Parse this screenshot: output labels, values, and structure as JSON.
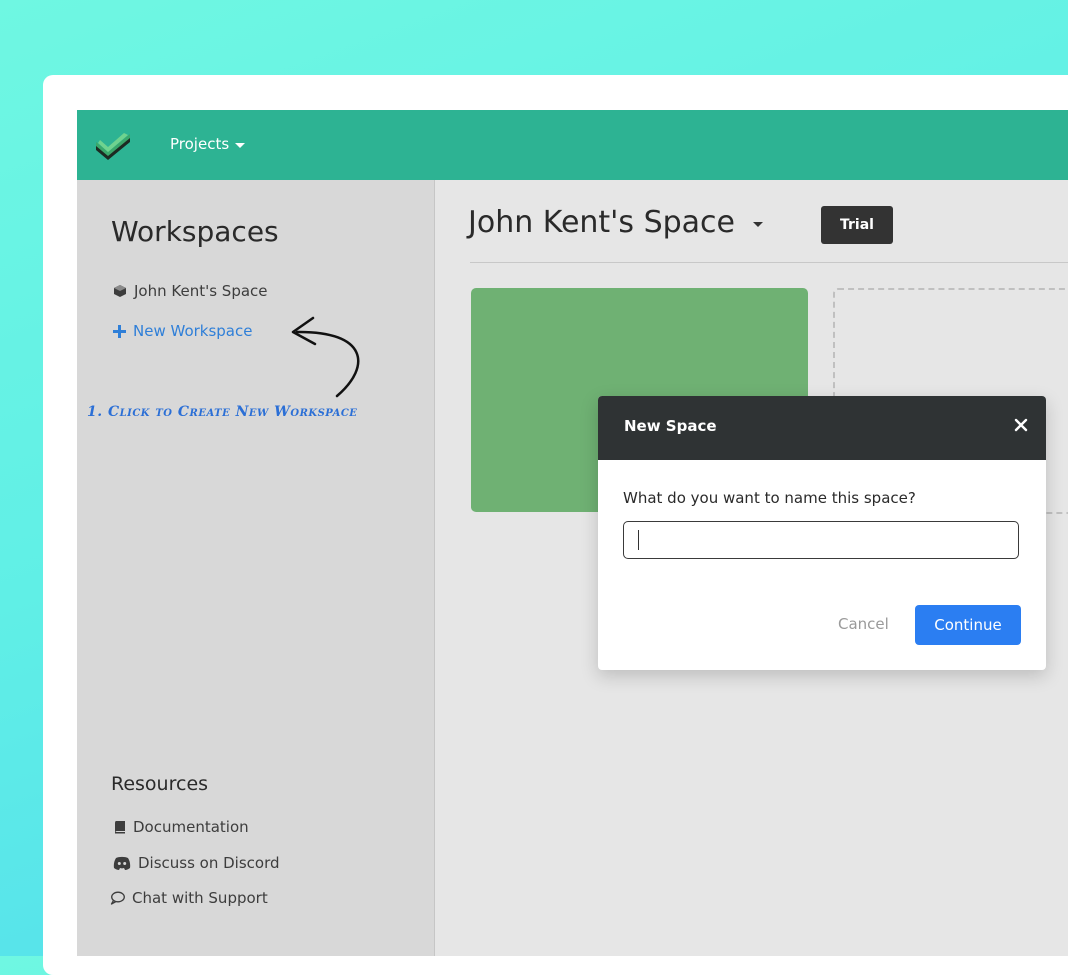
{
  "topbar": {
    "projects_label": "Projects"
  },
  "sidebar": {
    "title": "Workspaces",
    "workspaces": [
      {
        "label": "John Kent's Space",
        "icon": "cube-icon"
      }
    ],
    "new_workspace_label": "New Workspace",
    "annotation": "1. Click to Create New Workspace",
    "resources_title": "Resources",
    "resources": [
      {
        "label": "Documentation",
        "icon": "book-icon"
      },
      {
        "label": "Discuss on Discord",
        "icon": "discord-icon"
      },
      {
        "label": "Chat with Support",
        "icon": "chat-bubble-icon"
      }
    ]
  },
  "main": {
    "space_name": "John Kent's Space",
    "plan_badge": "Trial"
  },
  "modal": {
    "title": "New Space",
    "question": "What do you want to name this space?",
    "input_value": "",
    "cancel_label": "Cancel",
    "continue_label": "Continue"
  },
  "colors": {
    "topbar": "#2db393",
    "card_green": "#6fb173",
    "primary_button": "#2b7ef2",
    "link_blue": "#2f7fd8",
    "annotation_blue": "#2b6fd6",
    "modal_header": "#2f3334"
  }
}
